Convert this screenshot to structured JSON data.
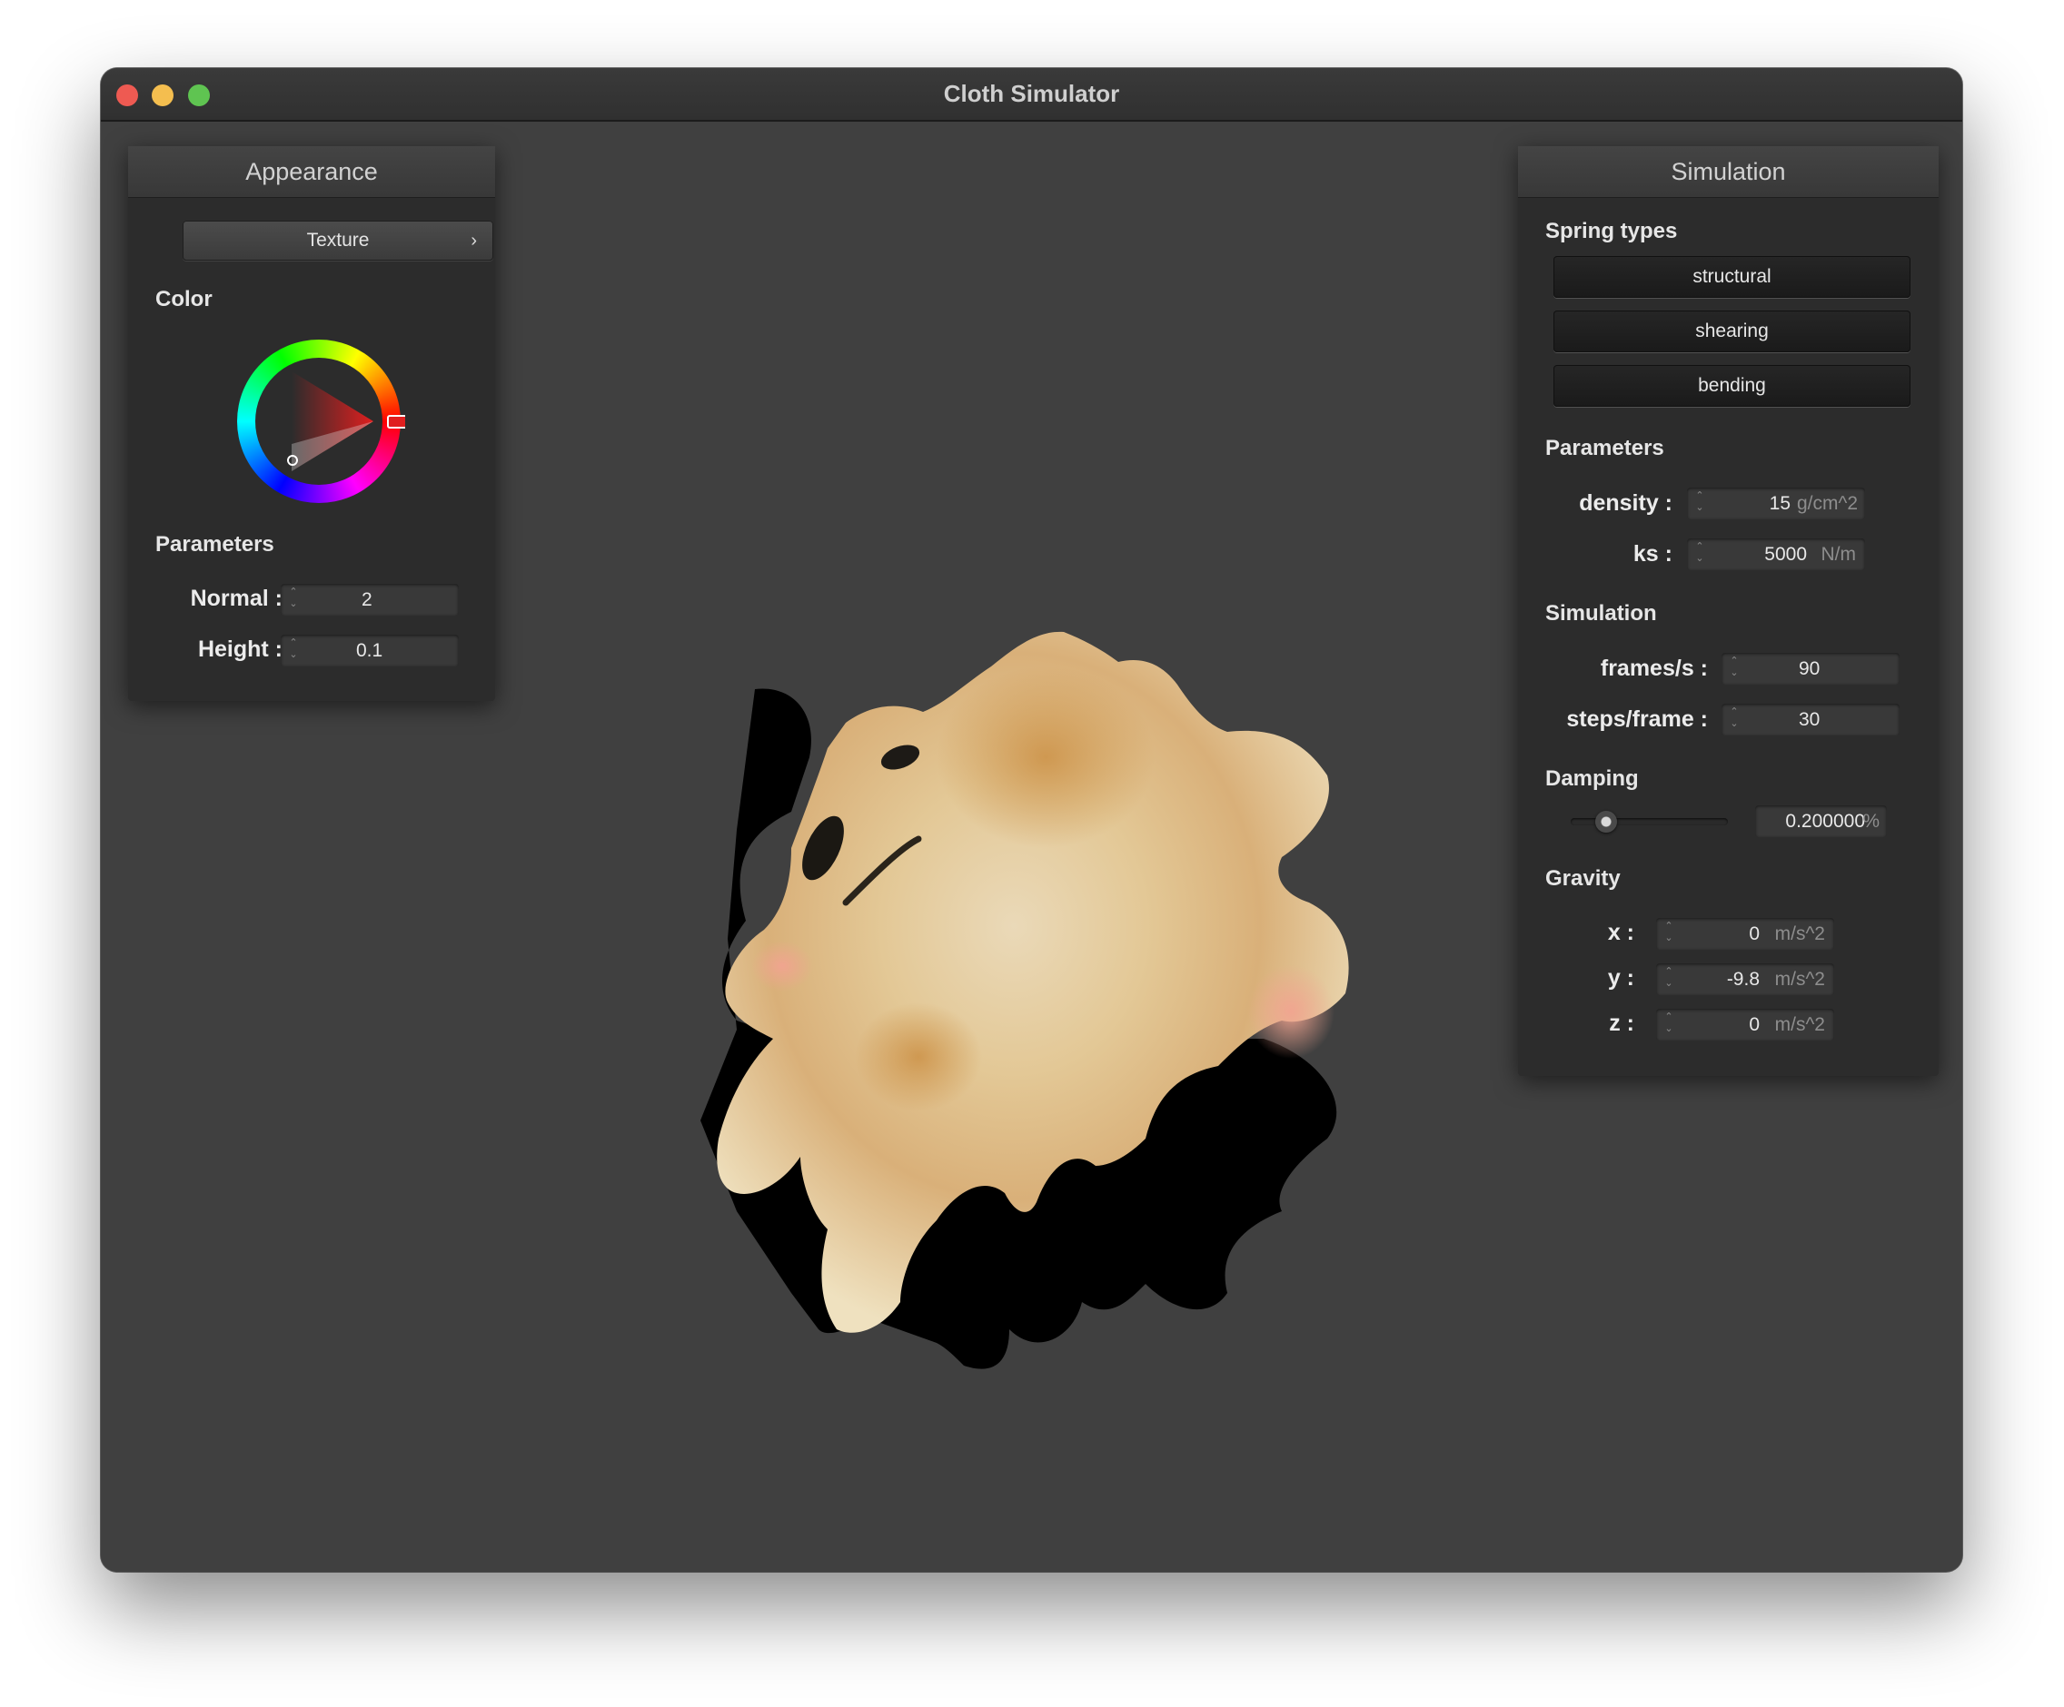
{
  "window": {
    "title": "Cloth Simulator"
  },
  "appearance": {
    "header": "Appearance",
    "texture_button": "Texture",
    "texture_chevron": "›",
    "color_label": "Color",
    "color_value": "#e01f1f",
    "parameters_label": "Parameters",
    "normal": {
      "label": "Normal :",
      "value": "2"
    },
    "height": {
      "label": "Height :",
      "value": "0.1"
    }
  },
  "simulation": {
    "header": "Simulation",
    "spring_types_label": "Spring types",
    "springs": [
      "structural",
      "shearing",
      "bending"
    ],
    "parameters_label": "Parameters",
    "density": {
      "label": "density :",
      "value": "15",
      "unit": "g/cm^2"
    },
    "ks": {
      "label": "ks :",
      "value": "5000",
      "unit": "N/m"
    },
    "simulation_label": "Simulation",
    "fps": {
      "label": "frames/s :",
      "value": "90"
    },
    "steps": {
      "label": "steps/frame :",
      "value": "30"
    },
    "damping_label": "Damping",
    "damping": {
      "value": "0.200000",
      "unit": "%",
      "fraction": 0.2
    },
    "gravity_label": "Gravity",
    "gravity": [
      {
        "label": "x :",
        "value": "0",
        "unit": "m/s^2"
      },
      {
        "label": "y :",
        "value": "-9.8",
        "unit": "m/s^2"
      },
      {
        "label": "z :",
        "value": "0",
        "unit": "m/s^2"
      }
    ]
  },
  "colors": {
    "viewport": "#404040",
    "panel": "#2c2c2c",
    "cloth": "#e7cfa2",
    "cloth_shadow": "#000000"
  }
}
